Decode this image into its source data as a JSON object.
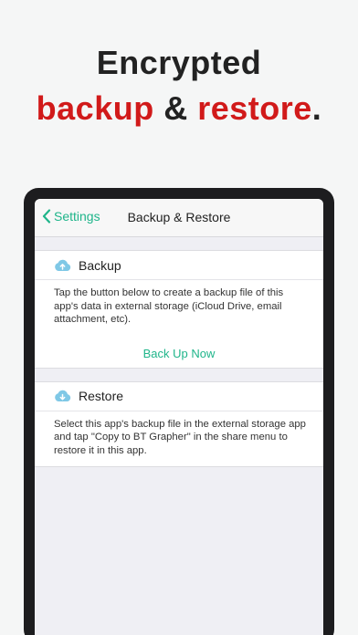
{
  "headline": {
    "line1": "Encrypted",
    "line2_part1": "backup",
    "line2_part2": " & ",
    "line2_part3": "restore",
    "line2_part4": "."
  },
  "navbar": {
    "back_label": "Settings",
    "title": "Backup & Restore"
  },
  "backup": {
    "header": "Backup",
    "description": "Tap the button below to create a backup file of this app's data in external storage (iCloud Drive, email attachment, etc).",
    "button_label": "Back Up Now"
  },
  "restore": {
    "header": "Restore",
    "description": "Select this app's backup file in the external storage app and tap \"Copy to BT Grapher\" in the share menu to restore it in this app."
  },
  "colors": {
    "accent": "#1fb58a",
    "headline_red": "#d11a1a",
    "icon_blue": "#7fc8e6"
  },
  "icons": {
    "back": "chevron-left-icon",
    "backup": "cloud-upload-icon",
    "restore": "cloud-download-icon"
  }
}
